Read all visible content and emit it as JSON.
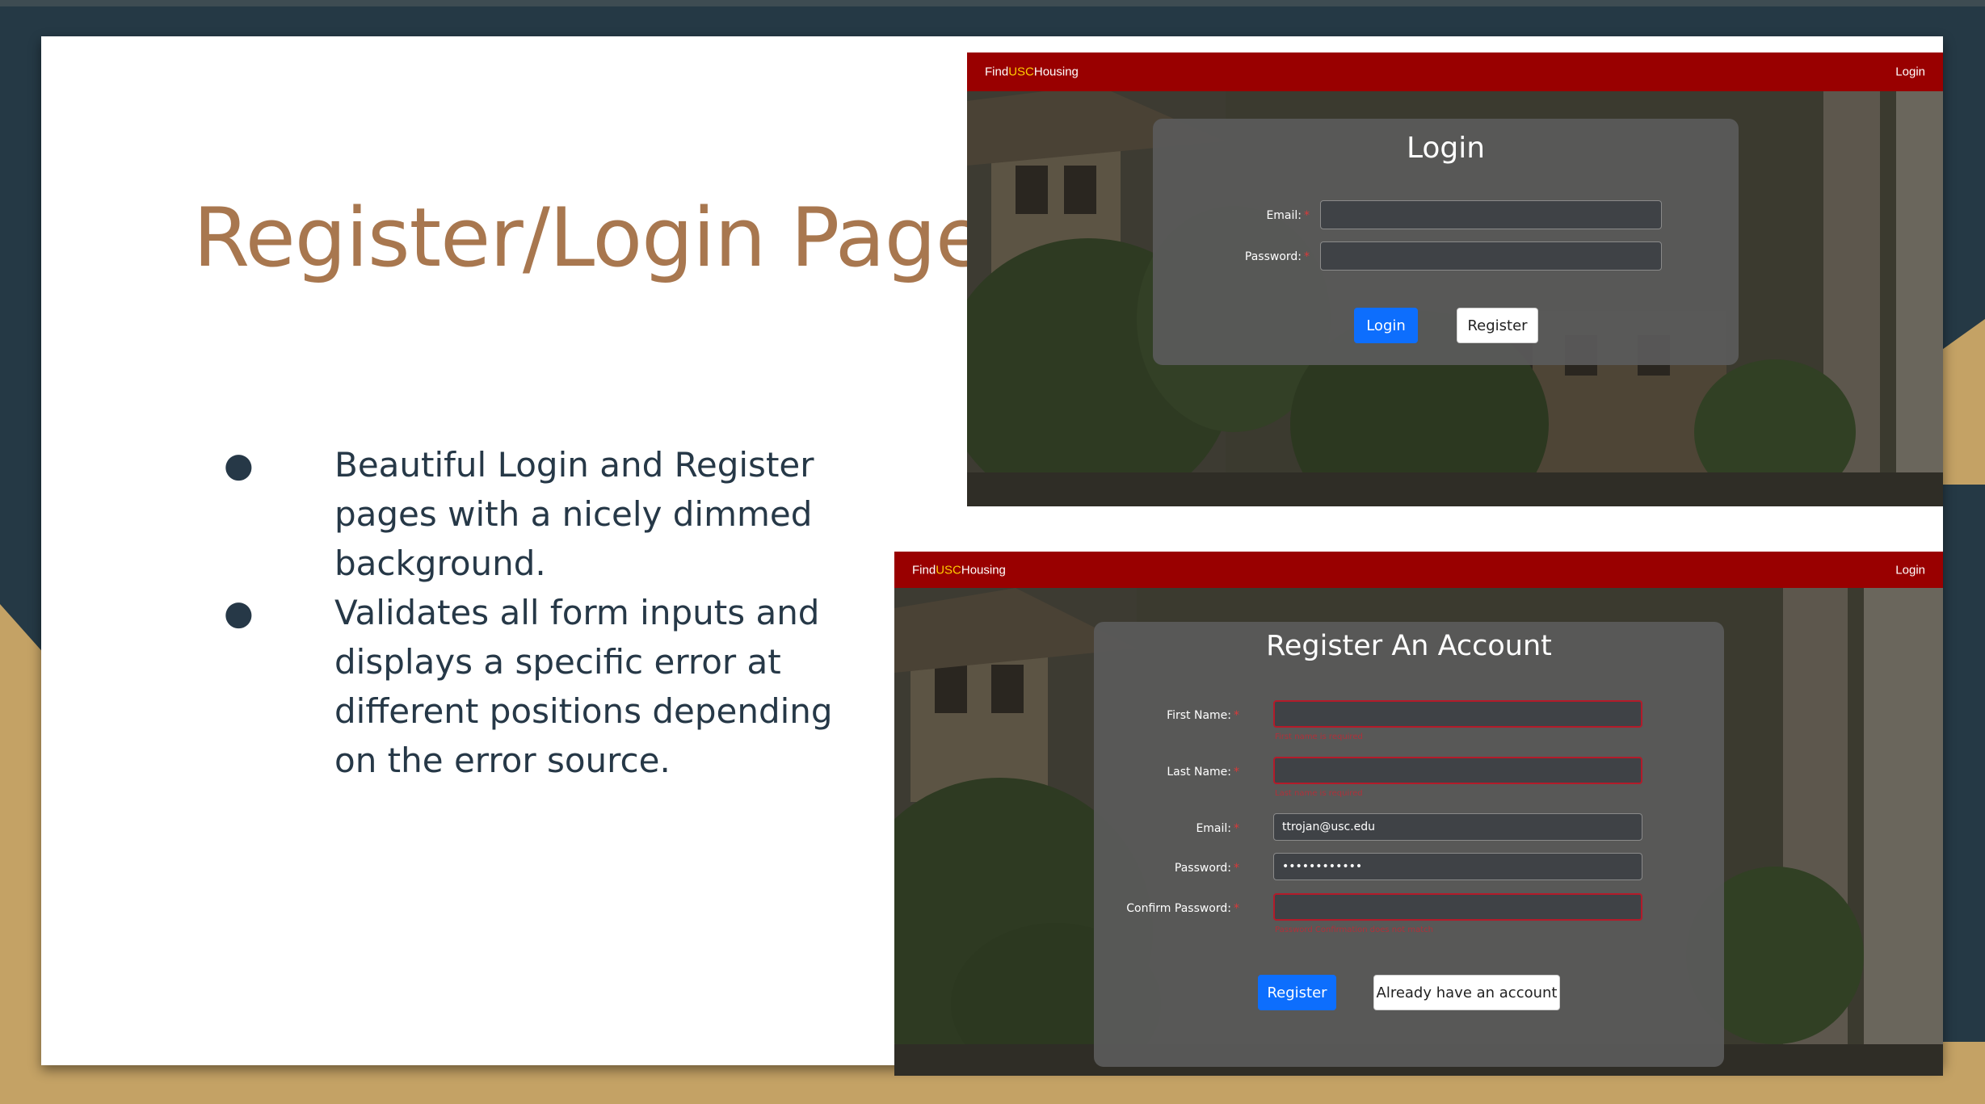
{
  "colors": {
    "background": "#253945",
    "accent_gold": "#c4a265",
    "title": "#a8774f",
    "body_text": "#263847",
    "navbar": "#990000",
    "brand_highlight": "#ffcc00",
    "primary_button": "#0d6efd",
    "error": "#b31b2a"
  },
  "slide": {
    "title": "Register/Login Page",
    "bullets": [
      "Beautiful Login and Register pages with a nicely dimmed background.",
      "Validates all form inputs and displays a specific error at different positions depending on the error source."
    ],
    "bullet_symbol": "●"
  },
  "login_screenshot": {
    "navbar": {
      "brand_prefix": "Find",
      "brand_highlight": "USC",
      "brand_suffix": "Housing",
      "login_link": "Login"
    },
    "card": {
      "title": "Login",
      "fields": [
        {
          "label": "Email:",
          "required_mark": "*",
          "value": ""
        },
        {
          "label": "Password:",
          "required_mark": "*",
          "value": ""
        }
      ],
      "login_button": "Login",
      "register_button": "Register"
    }
  },
  "register_screenshot": {
    "navbar": {
      "brand_prefix": "Find",
      "brand_highlight": "USC",
      "brand_suffix": "Housing",
      "login_link": "Login"
    },
    "card": {
      "title": "Register An Account",
      "fields": [
        {
          "label": "First Name:",
          "required_mark": "*",
          "value": "",
          "error": "First name is required"
        },
        {
          "label": "Last Name:",
          "required_mark": "*",
          "value": "",
          "error": "Last name is required"
        },
        {
          "label": "Email:",
          "required_mark": "*",
          "value": "ttrojan@usc.edu",
          "error": ""
        },
        {
          "label": "Password:",
          "required_mark": "*",
          "value": "••••••••••••",
          "error": ""
        },
        {
          "label": "Confirm Password:",
          "required_mark": "*",
          "value": "",
          "error": "Password Confirmation does not match"
        }
      ],
      "register_button": "Register",
      "login_instead_button": "Already have an account"
    }
  }
}
